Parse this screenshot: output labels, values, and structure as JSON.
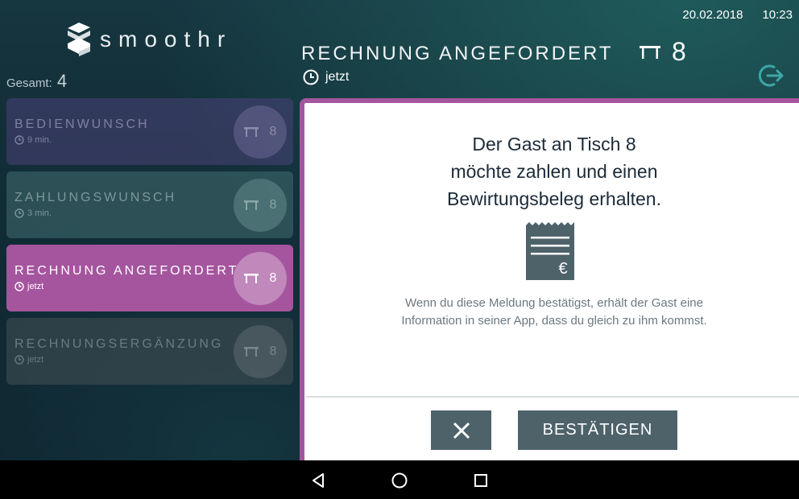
{
  "status_bar": {
    "date": "20.02.2018",
    "time": "10:23"
  },
  "app": {
    "logo_text": "smoothr"
  },
  "sidebar": {
    "total_label": "Gesamt:",
    "total_count": "4",
    "requests": [
      {
        "title": "BEDIENWUNSCH",
        "time": "9 min.",
        "table": "8",
        "state": "inactive"
      },
      {
        "title": "ZAHLUNGSWUNSCH",
        "time": "3 min.",
        "table": "8",
        "state": "inactive"
      },
      {
        "title": "RECHNUNG ANGEFORDERT",
        "time": "jetzt",
        "table": "8",
        "state": "active"
      },
      {
        "title": "RECHNUNGSERGÄNZUNG",
        "time": "jetzt",
        "table": "8",
        "state": "inactive"
      }
    ]
  },
  "detail": {
    "title": "RECHNUNG ANGEFORDERT",
    "table_number": "8",
    "time": "jetzt",
    "headline": [
      "Der Gast an Tisch 8",
      "möchte zahlen und einen",
      "Bewirtungsbeleg erhalten."
    ],
    "info": [
      "Wenn du diese Meldung bestätigst, erhält der Gast eine",
      "Information in seiner App, dass du gleich zu ihm kommst."
    ],
    "confirm_label": "BESTÄTIGEN",
    "cancel_icon": "close-icon"
  },
  "colors": {
    "accent": "#a5559e",
    "button": "#4e626a",
    "text_dark": "#1c2b38"
  },
  "navbar": {
    "icons": [
      "back-icon",
      "home-icon",
      "recents-icon"
    ]
  }
}
